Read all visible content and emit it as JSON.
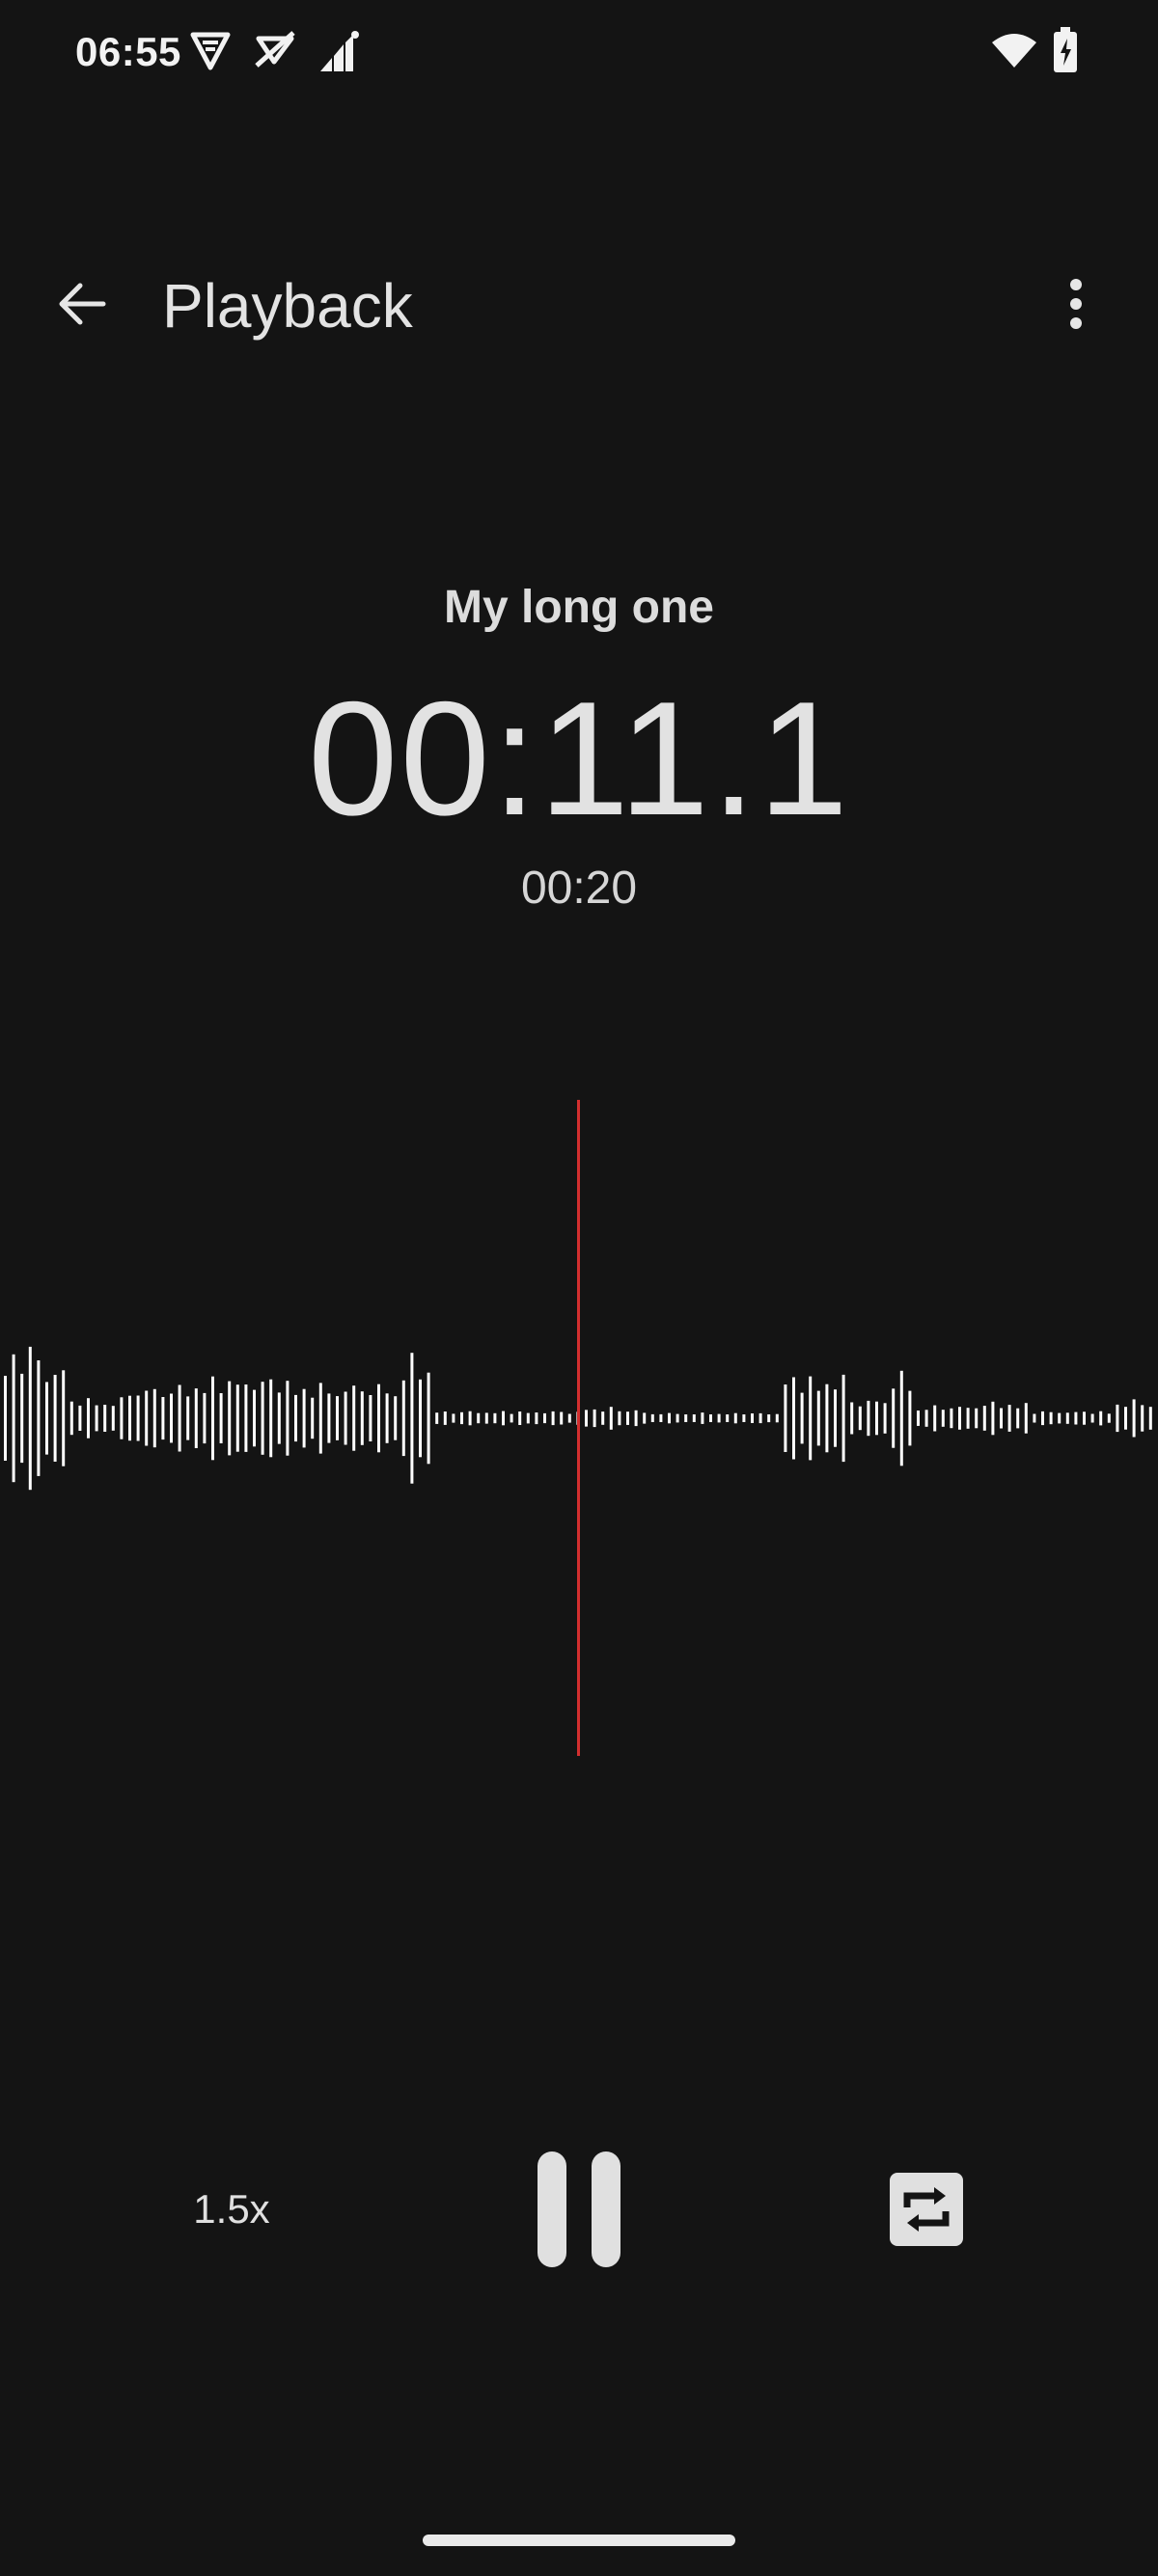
{
  "status_bar": {
    "time": "06:55",
    "icons": [
      "vpn-shield-icon",
      "no-signal-app-icon",
      "cellular-signal-icon",
      "wifi-icon",
      "battery-charging-icon"
    ]
  },
  "app_bar": {
    "title": "Playback",
    "back_icon": "arrow-back-icon",
    "more_icon": "more-vert-icon"
  },
  "recording": {
    "name": "My long one",
    "current_time": "00:11.1",
    "total_time": "00:20"
  },
  "controls": {
    "speed_label": "1.5x",
    "pause_icon": "pause-icon",
    "loop_icon": "repeat-icon"
  },
  "colors": {
    "background": "#141414",
    "text": "#e6e6e6",
    "playhead": "#d32f2f",
    "waveform": "#ffffff"
  }
}
